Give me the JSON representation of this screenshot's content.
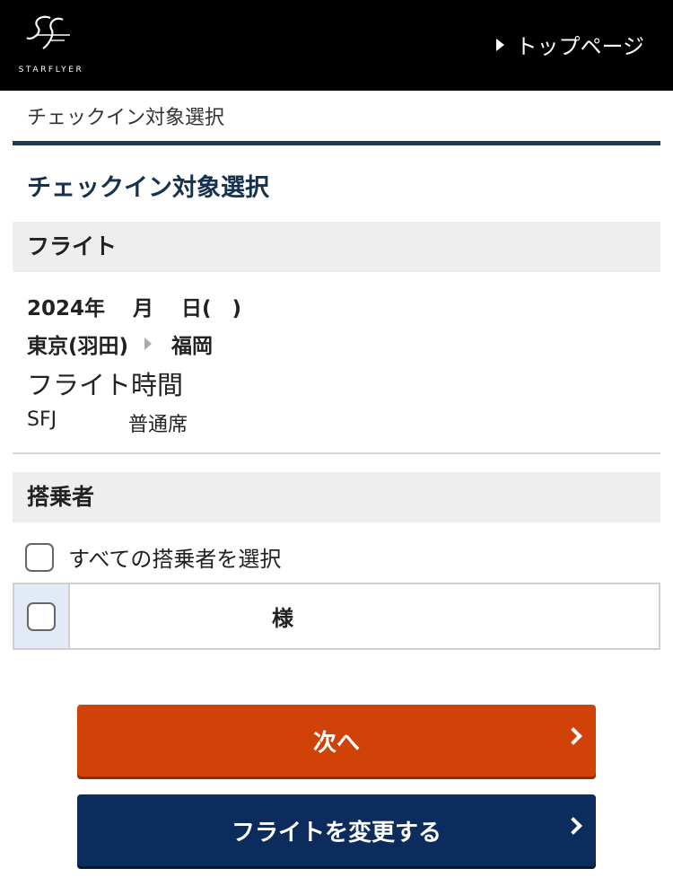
{
  "header": {
    "logo_text": "STARFLYER",
    "top_link": "トップページ"
  },
  "breadcrumb": "チェックイン対象選択",
  "page_title": "チェックイン対象選択",
  "flight_section": {
    "heading": "フライト",
    "date": "2024年　 月　 日(　)",
    "origin": "東京(羽田)",
    "destination": "福岡",
    "time_label": "フライト時間",
    "code": "SFJ",
    "seat_class": "普通席"
  },
  "passenger_section": {
    "heading": "搭乗者",
    "select_all_label": "すべての搭乗者を選択",
    "passengers": [
      {
        "name": "様"
      }
    ]
  },
  "buttons": {
    "next": "次へ",
    "change_flight": "フライトを変更する"
  }
}
